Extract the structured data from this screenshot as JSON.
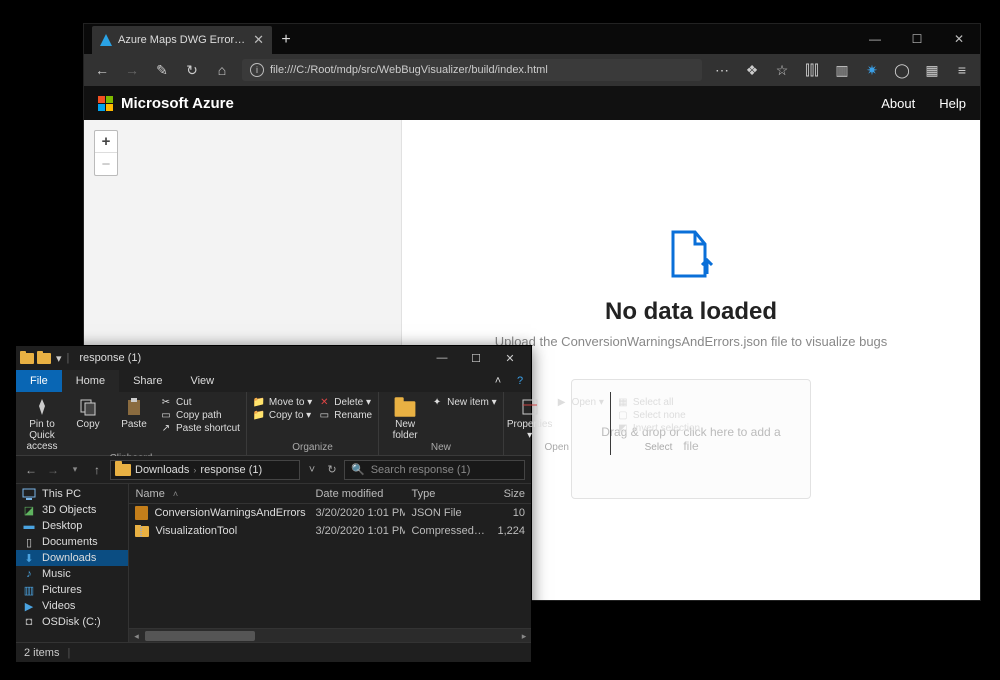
{
  "browser": {
    "tab_title": "Azure Maps DWG Errors Visual...",
    "new_tab": "+",
    "win": {
      "min": "—",
      "max": "☐",
      "close": "✕"
    },
    "toolbar": {
      "back": "←",
      "forward": "→",
      "wand": "✎",
      "reload": "↻",
      "home": "⌂",
      "info": "i",
      "url": "file:///C:/Root/mdp/src/WebBugVisualizer/build/index.html",
      "dots": "⋯",
      "shield": "❖",
      "star": "☆",
      "library": "⫿⫿⫿",
      "pocket": "▥",
      "ext": "✷",
      "account": "◯",
      "grid": "▦",
      "menu": "≡"
    }
  },
  "azure": {
    "brand": "Microsoft Azure",
    "links": {
      "about": "About",
      "help": "Help"
    }
  },
  "viewer": {
    "zoom_in": "+",
    "zoom_out": "−",
    "title": "No data loaded",
    "subtitle": "Upload the ConversionWarningsAndErrors.json file to visualize bugs",
    "dropzone": "Drag & drop or click here to add a file"
  },
  "explorer": {
    "title": "response (1)",
    "win": {
      "min": "—",
      "max": "☐",
      "close": "✕"
    },
    "tabs": {
      "file": "File",
      "home": "Home",
      "share": "Share",
      "view": "View",
      "chev": "˄",
      "help": "?"
    },
    "ribbon": {
      "clipboard": {
        "pin": "Pin to Quick access",
        "copy": "Copy",
        "paste": "Paste",
        "cut": "Cut",
        "copypath": "Copy path",
        "shortcut": "Paste shortcut",
        "label": "Clipboard"
      },
      "organize": {
        "moveto": "Move to ▾",
        "copyto": "Copy to ▾",
        "delete": "Delete ▾",
        "rename": "Rename",
        "label": "Organize"
      },
      "new": {
        "folder": "New folder",
        "item": "New item ▾",
        "label": "New"
      },
      "open": {
        "properties": "Properties ▾",
        "open": "Open ▾",
        "label": "Open"
      },
      "select": {
        "all": "Select all",
        "none": "Select none",
        "invert": "Invert selection",
        "label": "Select"
      }
    },
    "nav": {
      "back": "←",
      "fwd": "→",
      "up": "↑"
    },
    "breadcrumb": {
      "a": "Downloads",
      "b": "response (1)"
    },
    "search_placeholder": "Search response (1)",
    "columns": {
      "name": "Name",
      "date": "Date modified",
      "type": "Type",
      "size": "Size"
    },
    "files": [
      {
        "name": "ConversionWarningsAndErrors",
        "date": "3/20/2020 1:01 PM",
        "type": "JSON File",
        "size": "10"
      },
      {
        "name": "VisualizationTool",
        "date": "3/20/2020 1:01 PM",
        "type": "Compressed (zipp...",
        "size": "1,224"
      }
    ],
    "navpane": [
      {
        "label": "This PC",
        "icon": "pc"
      },
      {
        "label": "3D Objects",
        "icon": "cube"
      },
      {
        "label": "Desktop",
        "icon": "desktop"
      },
      {
        "label": "Documents",
        "icon": "doc"
      },
      {
        "label": "Downloads",
        "icon": "down",
        "selected": true
      },
      {
        "label": "Music",
        "icon": "music"
      },
      {
        "label": "Pictures",
        "icon": "pic"
      },
      {
        "label": "Videos",
        "icon": "video"
      },
      {
        "label": "OSDisk (C:)",
        "icon": "disk"
      }
    ],
    "status": "2 items"
  }
}
